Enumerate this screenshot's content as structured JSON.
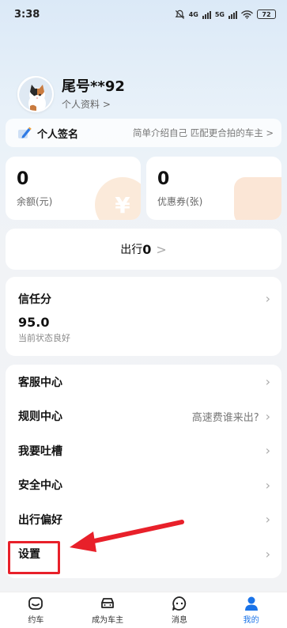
{
  "status_bar": {
    "time": "3:38",
    "net1": "4G",
    "net2": "5G",
    "battery": "72"
  },
  "profile": {
    "name": "尾号**92",
    "link": "个人资料 >"
  },
  "signature": {
    "label": "个人签名",
    "hint": "简单介绍自己 匹配更合拍的车主 >"
  },
  "stats": [
    {
      "value": "0",
      "label": "余额(元)"
    },
    {
      "value": "0",
      "label": "优惠券(张)"
    }
  ],
  "trips": {
    "label": "出行",
    "count": "0",
    "chevron": ">"
  },
  "trust": {
    "title": "信任分",
    "score": "95.0",
    "status": "当前状态良好"
  },
  "menu": [
    {
      "label": "客服中心",
      "hint": ""
    },
    {
      "label": "规则中心",
      "hint": "高速费谁来出?"
    },
    {
      "label": "我要吐槽",
      "hint": ""
    },
    {
      "label": "安全中心",
      "hint": ""
    },
    {
      "label": "出行偏好",
      "hint": ""
    },
    {
      "label": "设置",
      "hint": ""
    }
  ],
  "tabs": [
    {
      "label": "约车",
      "icon": "car-front-icon"
    },
    {
      "label": "成为车主",
      "icon": "car-icon"
    },
    {
      "label": "消息",
      "icon": "chat-icon"
    },
    {
      "label": "我的",
      "icon": "user-icon"
    }
  ],
  "colors": {
    "accent": "#1a73e8",
    "highlight": "#e8202a"
  }
}
